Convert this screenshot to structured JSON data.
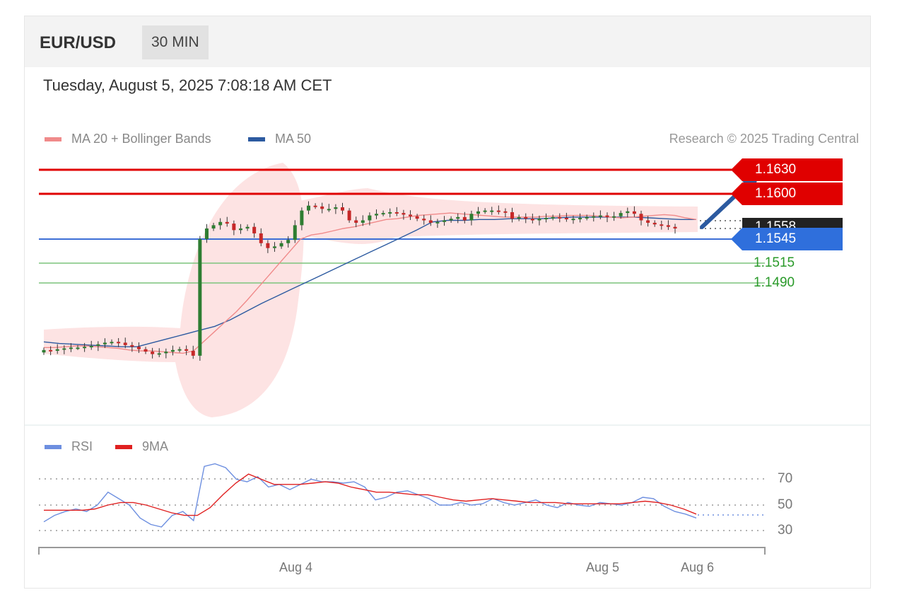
{
  "header": {
    "pair": "EUR/USD",
    "timeframe": "30 MIN"
  },
  "date": "Tuesday, August 5, 2025 7:08:18 AM CET",
  "legend": {
    "ma20": {
      "label": "MA 20 + Bollinger Bands",
      "color": "#f08a8a"
    },
    "ma50": {
      "label": "MA 50",
      "color": "#2c5aa0"
    }
  },
  "credit": "Research © 2025 Trading Central",
  "levels": {
    "r2": "1.1630",
    "r1": "1.1600",
    "last": "1.1558",
    "pivot": "1.1545",
    "s1": "1.1515",
    "s2": "1.1490"
  },
  "rsi_legend": {
    "rsi": {
      "label": "RSI",
      "color": "#6d8fe0"
    },
    "ma9": {
      "label": "9MA",
      "color": "#e02020"
    }
  },
  "rsi_levels": [
    "70",
    "50",
    "30"
  ],
  "xaxis": {
    "aug4": "Aug 4",
    "aug5": "Aug 5",
    "aug6": "Aug 6"
  },
  "chart_data": {
    "type": "line",
    "title": "EUR/USD",
    "price_range": [
      1.137,
      1.164
    ],
    "rsi_range": [
      25,
      85
    ],
    "close": [
      1.1409,
      1.1408,
      1.141,
      1.1411,
      1.1412,
      1.1412,
      1.1413,
      1.1414,
      1.1416,
      1.1418,
      1.1419,
      1.1418,
      1.1415,
      1.1413,
      1.141,
      1.1407,
      1.1404,
      1.1405,
      1.1407,
      1.1409,
      1.141,
      1.1408,
      1.1402,
      1.1545,
      1.1558,
      1.1562,
      1.1566,
      1.1564,
      1.1556,
      1.1558,
      1.156,
      1.1552,
      1.154,
      1.1534,
      1.1536,
      1.154,
      1.1544,
      1.1562,
      1.158,
      1.1586,
      1.1585,
      1.1582,
      1.1582,
      1.1584,
      1.158,
      1.1568,
      1.1565,
      1.1568,
      1.1574,
      1.1576,
      1.1577,
      1.1578,
      1.1577,
      1.1575,
      1.1573,
      1.157,
      1.1568,
      1.1565,
      1.1566,
      1.1568,
      1.157,
      1.1572,
      1.1568,
      1.1576,
      1.1579,
      1.158,
      1.158,
      1.1579,
      1.1578,
      1.157,
      1.1572,
      1.157,
      1.1568,
      1.157,
      1.1571,
      1.1572,
      1.1571,
      1.157,
      1.157,
      1.1571,
      1.1572,
      1.1573,
      1.1574,
      1.1572,
      1.1573,
      1.1577,
      1.1579,
      1.1576,
      1.1568,
      1.1565,
      1.1563,
      1.1562,
      1.156,
      1.1558
    ],
    "ma20": [
      1.1412,
      1.1412,
      1.1413,
      1.1414,
      1.1414,
      1.1413,
      1.1412,
      1.1411,
      1.1409,
      1.1408,
      1.1408,
      1.1407,
      1.1406,
      1.1405,
      1.1408,
      1.142,
      1.1432,
      1.1444,
      1.1456,
      1.147,
      1.1485,
      1.15,
      1.1515,
      1.153,
      1.1545,
      1.155,
      1.1552,
      1.1555,
      1.1558,
      1.156,
      1.1563,
      1.1566,
      1.1569,
      1.157,
      1.1572,
      1.1574,
      1.1575,
      1.1576,
      1.1577,
      1.1576,
      1.1575,
      1.1574,
      1.1573,
      1.1572,
      1.1572,
      1.1572,
      1.1572,
      1.1573,
      1.1573,
      1.1574,
      1.1574,
      1.1574,
      1.1573,
      1.1572,
      1.1571,
      1.1572,
      1.1573,
      1.1574,
      1.1575,
      1.1574,
      1.1571,
      1.1569
    ],
    "ma50": [
      1.1419,
      1.1417,
      1.1416,
      1.1415,
      1.1414,
      1.1413,
      1.1413,
      1.1418,
      1.1423,
      1.1428,
      1.1433,
      1.1438,
      1.1446,
      1.1456,
      1.1466,
      1.1475,
      1.1484,
      1.1493,
      1.1502,
      1.1511,
      1.152,
      1.1529,
      1.1538,
      1.1547,
      1.1556,
      1.1566,
      1.1568,
      1.1568,
      1.1569,
      1.1569,
      1.157,
      1.157,
      1.157,
      1.1571,
      1.1572,
      1.1572,
      1.1572,
      1.1572,
      1.1572,
      1.1571,
      1.157,
      1.1569,
      1.1569
    ],
    "rsi": [
      37,
      42,
      45,
      47,
      45,
      50,
      60,
      55,
      50,
      40,
      35,
      33,
      42,
      45,
      38,
      80,
      82,
      79,
      70,
      68,
      72,
      64,
      66,
      62,
      66,
      70,
      68,
      68,
      67,
      68,
      64,
      54,
      56,
      60,
      61,
      58,
      55,
      50,
      50,
      52,
      50,
      51,
      55,
      52,
      50,
      52,
      54,
      50,
      48,
      52,
      50,
      49,
      52,
      51,
      50,
      52,
      56,
      55,
      49,
      45,
      43,
      40
    ],
    "rsi_ma9": [
      46,
      46,
      46,
      46,
      47,
      50,
      52,
      52,
      50,
      47,
      44,
      42,
      42,
      48,
      58,
      67,
      74,
      70,
      66,
      66,
      66,
      67,
      68,
      67,
      64,
      62,
      60,
      60,
      59,
      58,
      58,
      56,
      54,
      53,
      54,
      55,
      54,
      53,
      52,
      52,
      52,
      51,
      51,
      51,
      51,
      51,
      52,
      53,
      52,
      50,
      47,
      43
    ]
  }
}
